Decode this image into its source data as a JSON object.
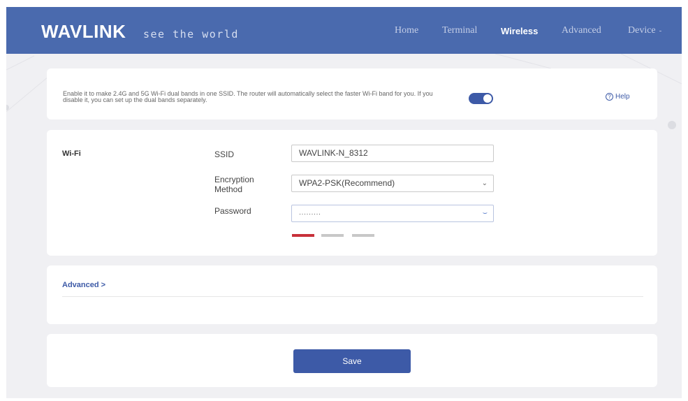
{
  "header": {
    "logo": "WAVLINK",
    "slogan": "see the world",
    "nav": [
      {
        "label": "Home",
        "active": false
      },
      {
        "label": "Terminal",
        "active": false
      },
      {
        "label": "Wireless",
        "active": true
      },
      {
        "label": "Advanced",
        "active": false
      },
      {
        "label": "Device",
        "active": false
      }
    ]
  },
  "smart_connect": {
    "description": "Enable it to make 2.4G and 5G Wi-Fi dual bands in one SSID. The router will automatically select the faster Wi-Fi band for you. If you disable it, you can set up the dual bands separately.",
    "toggle_on": true,
    "help_label": "Help",
    "help_icon": "question-circle-icon"
  },
  "wifi": {
    "section_label": "Wi-Fi",
    "ssid_label": "SSID",
    "ssid_value": "WAVLINK-N_8312",
    "encryption_label": "Encryption Method",
    "encryption_value": "WPA2-PSK(Recommend)",
    "password_label": "Password",
    "password_value": "·········",
    "password_strength_level": 1,
    "password_strength_max": 3
  },
  "advanced": {
    "label": "Advanced",
    "chevron": ">"
  },
  "actions": {
    "save_label": "Save"
  },
  "colors": {
    "header_bg": "#4a6aae",
    "accent": "#3d5aa7",
    "strength_weak": "#c8303a",
    "page_bg": "#f0f0f3"
  }
}
